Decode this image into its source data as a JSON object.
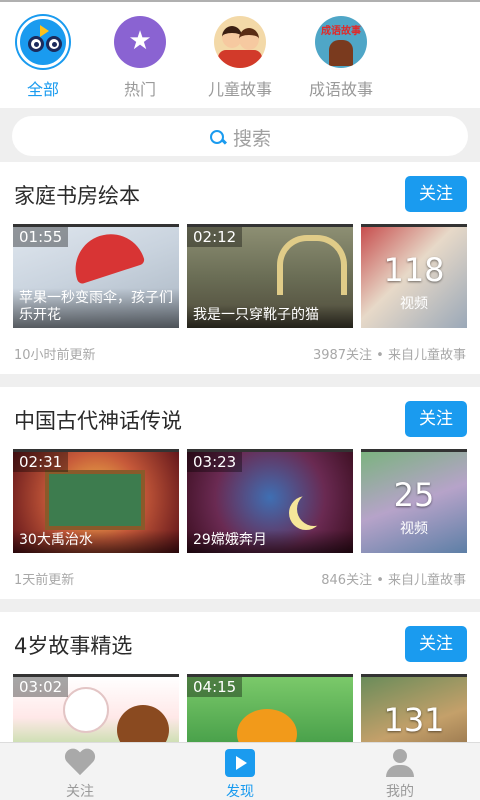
{
  "categories": [
    {
      "label": "全部",
      "active": true,
      "icon": "cartoon-eyes-icon"
    },
    {
      "label": "热门",
      "active": false,
      "icon": "star-icon"
    },
    {
      "label": "儿童故事",
      "active": false,
      "icon": "children-story-avatar"
    },
    {
      "label": "成语故事",
      "active": false,
      "icon": "idiom-story-avatar"
    }
  ],
  "idiom_avatar_text": "成语故事",
  "search": {
    "placeholder": "搜索"
  },
  "colors": {
    "accent": "#1a9bef",
    "muted": "#9a9a9a",
    "background": "#efefef"
  },
  "sections": [
    {
      "title": "家庭书房绘本",
      "follow_label": "关注",
      "videos": [
        {
          "duration": "01:55",
          "title": "苹果一秒变雨伞，孩子们乐开花"
        },
        {
          "duration": "02:12",
          "title": "我是一只穿靴子的猫"
        }
      ],
      "more_count": "118",
      "more_label": "视频",
      "updated": "10小时前更新",
      "stats": "3987关注 • 来自儿童故事"
    },
    {
      "title": "中国古代神话传说",
      "follow_label": "关注",
      "videos": [
        {
          "duration": "02:31",
          "title": "30大禹治水"
        },
        {
          "duration": "03:23",
          "title": "29嫦娥奔月"
        }
      ],
      "more_count": "25",
      "more_label": "视频",
      "updated": "1天前更新",
      "stats": "846关注 • 来自儿童故事"
    },
    {
      "title": "4岁故事精选",
      "follow_label": "关注",
      "videos": [
        {
          "duration": "03:02",
          "title": ""
        },
        {
          "duration": "04:15",
          "title": ""
        }
      ],
      "more_count": "131",
      "more_label": "",
      "updated": "",
      "stats": ""
    }
  ],
  "bottom_nav": [
    {
      "label": "关注",
      "icon": "heart-icon",
      "active": false
    },
    {
      "label": "发现",
      "icon": "play-box-icon",
      "active": true
    },
    {
      "label": "我的",
      "icon": "user-icon",
      "active": false
    }
  ]
}
